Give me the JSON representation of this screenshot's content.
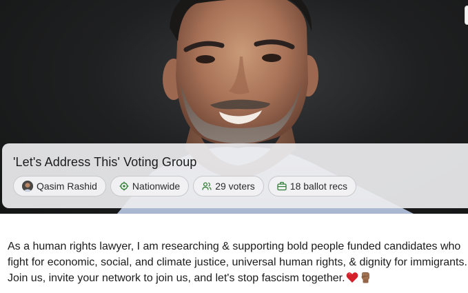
{
  "group": {
    "title": "'Let's Address This' Voting Group",
    "chips": {
      "author": {
        "label": "Qasim Rashid",
        "icon": "avatar"
      },
      "scope": {
        "label": "Nationwide",
        "icon": "location-target-icon"
      },
      "voters": {
        "label": "29 voters",
        "icon": "users-icon"
      },
      "ballot": {
        "label": "18 ballot recs",
        "icon": "briefcase-icon"
      }
    }
  },
  "description": {
    "text": "As a human rights lawyer, I am researching & supporting bold people funded candidates who fight for economic, social, and climate justice, universal human rights, & dignity for immigrants. Join us, invite your network to join us, and let's stop fascism together.",
    "emojis": [
      "red-heart-icon",
      "raised-fist-icon"
    ]
  },
  "colors": {
    "accent_green": "#2e7d32",
    "chip_border": "#c9c9cc",
    "card_bg": "#ececee"
  }
}
